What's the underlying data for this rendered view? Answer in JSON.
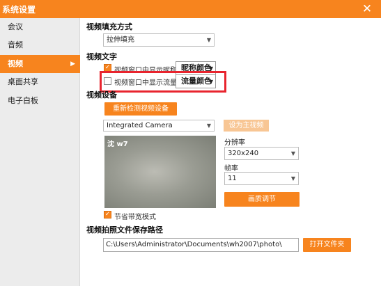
{
  "window": {
    "title": "系统设置",
    "close_glyph": "✕"
  },
  "sidebar": {
    "items": [
      {
        "label": "会议",
        "active": false
      },
      {
        "label": "音频",
        "active": false
      },
      {
        "label": "视频",
        "active": true,
        "arrow": "▶"
      },
      {
        "label": "桌面共享",
        "active": false
      },
      {
        "label": "电子白板",
        "active": false
      }
    ]
  },
  "fill_mode": {
    "title": "视频填充方式",
    "selected": "拉伸填充"
  },
  "video_text": {
    "title": "视频文字",
    "show_nickname": {
      "label": "视频窗口中显示昵称",
      "checked": true
    },
    "nickname_color_label": "昵称颜色",
    "show_traffic": {
      "label": "视频窗口中显示流量",
      "checked": false
    },
    "traffic_color_label": "流量颜色"
  },
  "device": {
    "title": "视频设备",
    "redetect_label": "重新检测视频设备",
    "camera_selected": "Integrated Camera",
    "set_main_label": "设为主视频",
    "preview_label": "沈 w7",
    "resolution_title": "分辨率",
    "resolution_selected": "320x240",
    "framerate_title": "帧率",
    "framerate_selected": "11",
    "quality_label": "画质调节",
    "bandwidth_saving": {
      "label": "节省带宽模式",
      "checked": true
    }
  },
  "snapshot": {
    "title": "视频拍照文件保存路径",
    "path": "C:\\Users\\Administrator\\Documents\\wh2007\\photo\\",
    "open_folder_label": "打开文件夹"
  },
  "glyphs": {
    "caret": "▼",
    "check": "✓"
  },
  "colors": {
    "accent": "#f7841e",
    "highlight": "#e8242e",
    "disabled_accent": "#f8c694"
  }
}
